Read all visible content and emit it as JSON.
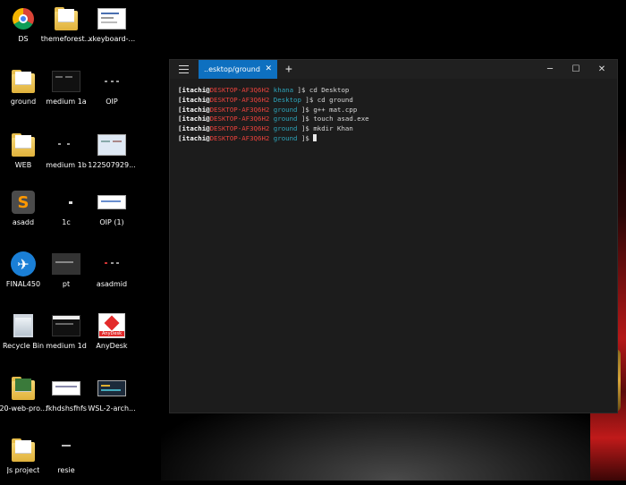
{
  "desktop": {
    "icons": [
      {
        "label": "DS",
        "type": "chrome"
      },
      {
        "label": "themeforest...",
        "type": "folder"
      },
      {
        "label": "xkeyboard-...",
        "type": "thumb"
      },
      {
        "label": "ground",
        "type": "folder"
      },
      {
        "label": "medium 1a",
        "type": "dark"
      },
      {
        "label": "OIP",
        "type": "small-dark"
      },
      {
        "label": "WEB",
        "type": "folder"
      },
      {
        "label": "medium 1b",
        "type": "small-dark"
      },
      {
        "label": "122507929...",
        "type": "thumb"
      },
      {
        "label": "asadd",
        "type": "sublime"
      },
      {
        "label": "1c",
        "type": "small-dark"
      },
      {
        "label": "OIP (1)",
        "type": "thumb"
      },
      {
        "label": "FINAL450",
        "type": "openoffice"
      },
      {
        "label": "pt",
        "type": "dark"
      },
      {
        "label": "asadmid",
        "type": "small-dark"
      },
      {
        "label": "Recycle Bin",
        "type": "recycle"
      },
      {
        "label": "medium 1d",
        "type": "dark"
      },
      {
        "label": "AnyDesk",
        "type": "anydesk"
      },
      {
        "label": "20-web-pro...",
        "type": "folder"
      },
      {
        "label": "fkhdshsfhfs",
        "type": "thumb"
      },
      {
        "label": "WSL-2-arch...",
        "type": "thumb"
      },
      {
        "label": "Js project",
        "type": "folder"
      },
      {
        "label": "resie",
        "type": "small-dark"
      }
    ],
    "anydesk_badge": "AnyDesk"
  },
  "terminal": {
    "tab_title": "..esktop/ground",
    "tab_close": "✕",
    "new_tab": "+",
    "minimize": "─",
    "maximize": "☐",
    "close": "✕",
    "lines": [
      {
        "user": "[itachi@",
        "host": "DESKTOP-AF3Q6H2",
        "dir": " khana ",
        "cmd": "]$ cd Desktop"
      },
      {
        "user": "[itachi@",
        "host": "DESKTOP-AF3Q6H2",
        "dir": " Desktop ",
        "cmd": "]$ cd ground"
      },
      {
        "user": "[itachi@",
        "host": "DESKTOP-AF3Q6H2",
        "dir": " ground ",
        "cmd": "]$ g++ mat.cpp"
      },
      {
        "user": "[itachi@",
        "host": "DESKTOP-AF3Q6H2",
        "dir": " ground ",
        "cmd": "]$ touch asad.exe"
      },
      {
        "user": "[itachi@",
        "host": "DESKTOP-AF3Q6H2",
        "dir": " ground ",
        "cmd": "]$ mkdir Khan"
      },
      {
        "user": "[itachi@",
        "host": "DESKTOP-AF3Q6H2",
        "dir": " ground ",
        "cmd": "]$ "
      }
    ]
  }
}
